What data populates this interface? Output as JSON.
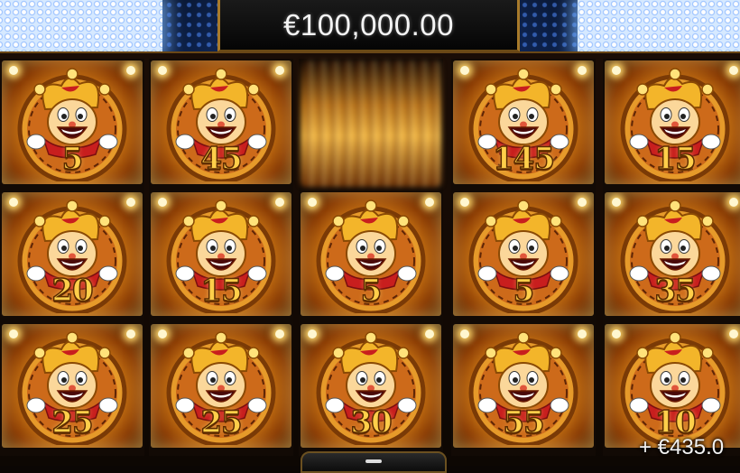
{
  "jackpot": {
    "amount": "€100,000.00"
  },
  "win": {
    "amount": "+ €435.0"
  },
  "reels": [
    {
      "id": "reel-1",
      "cells": [
        {
          "symbol": "jester-coin",
          "value": "5"
        },
        {
          "symbol": "jester-coin",
          "value": "20"
        },
        {
          "symbol": "jester-coin",
          "value": "25"
        }
      ]
    },
    {
      "id": "reel-2",
      "cells": [
        {
          "symbol": "jester-coin",
          "value": "45"
        },
        {
          "symbol": "jester-coin",
          "value": "15"
        },
        {
          "symbol": "jester-coin",
          "value": "25"
        }
      ]
    },
    {
      "id": "reel-3",
      "cells": [
        {
          "symbol": "spinning-blur",
          "value": ""
        },
        {
          "symbol": "jester-coin",
          "value": "5"
        },
        {
          "symbol": "jester-coin",
          "value": "30"
        }
      ]
    },
    {
      "id": "reel-4",
      "cells": [
        {
          "symbol": "jester-coin",
          "value": "145"
        },
        {
          "symbol": "jester-coin",
          "value": "5"
        },
        {
          "symbol": "jester-coin",
          "value": "55"
        }
      ]
    },
    {
      "id": "reel-5",
      "cells": [
        {
          "symbol": "jester-coin",
          "value": "15"
        },
        {
          "symbol": "jester-coin",
          "value": "35"
        },
        {
          "symbol": "jester-coin",
          "value": "10"
        }
      ]
    }
  ],
  "colors": {
    "gold": "#ffcf4a",
    "coinCenter": "#ffd56a",
    "coinEdge": "#8a3c05",
    "jesterRed": "#c81e1e",
    "lightBlue": "#d6e9ff"
  }
}
